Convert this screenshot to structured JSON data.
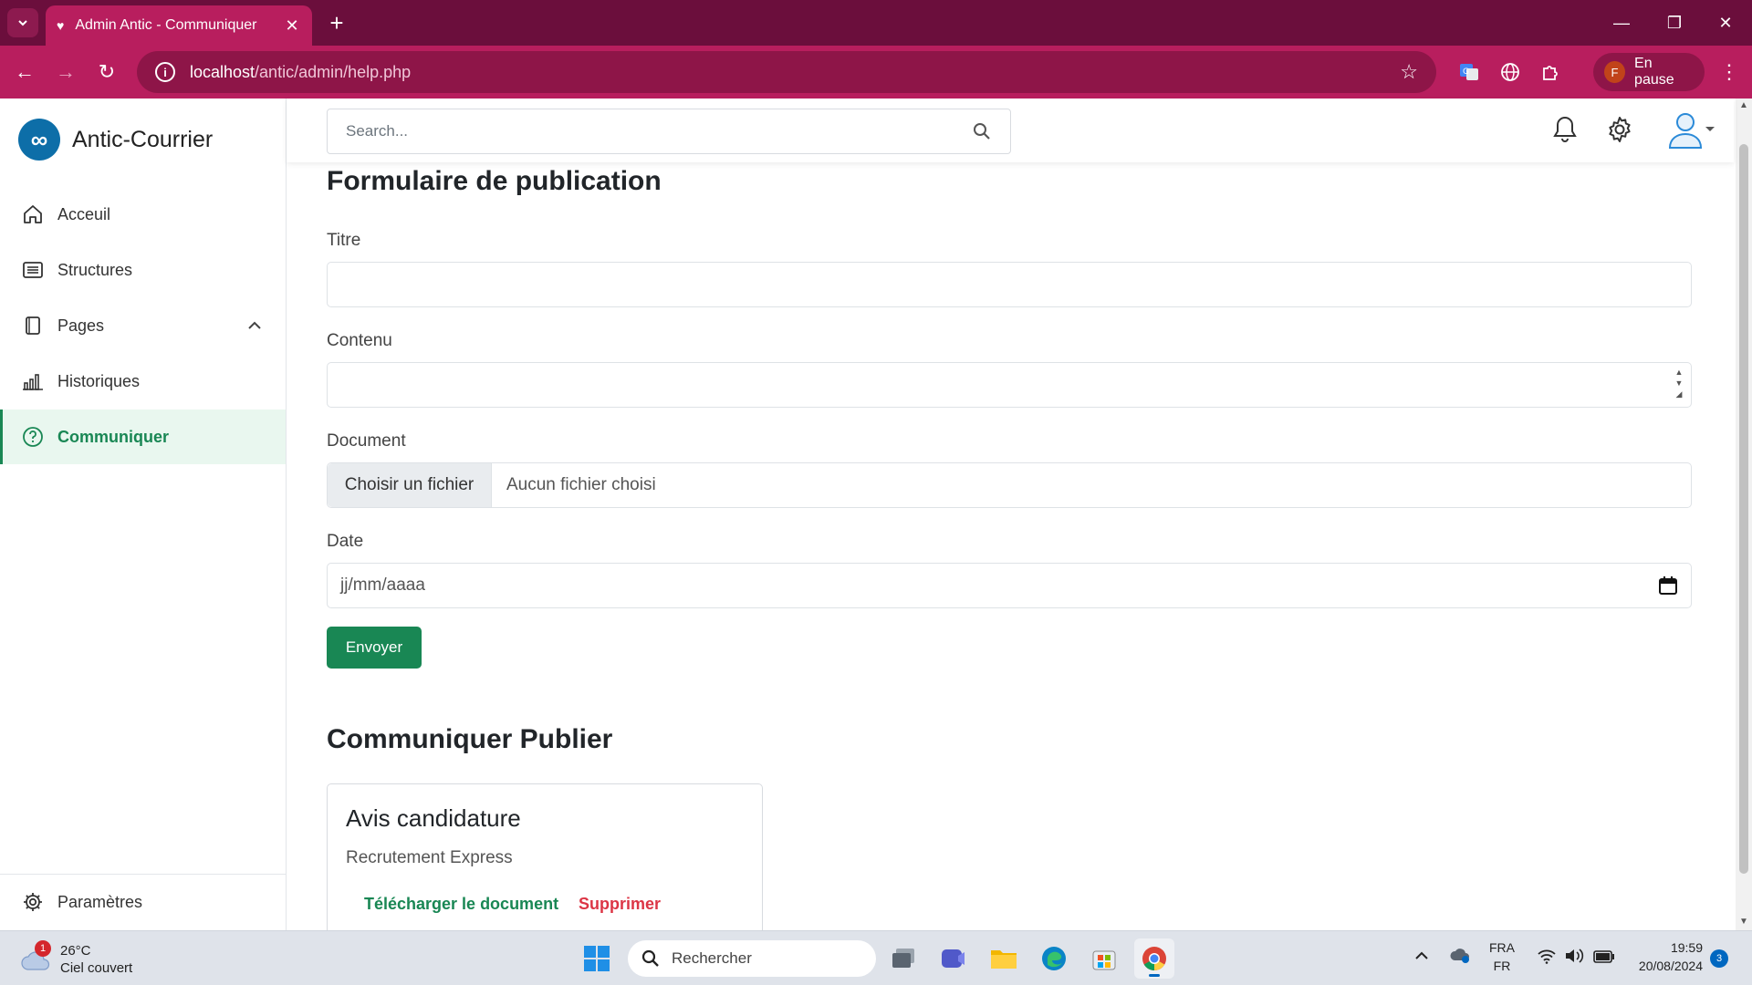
{
  "browser": {
    "tab_title": "Admin Antic - Communiquer",
    "url_host": "localhost",
    "url_path": "/antic/admin/help.php",
    "profile_initial": "F",
    "profile_status": "En pause"
  },
  "sidebar": {
    "brand": "Antic-Courrier",
    "items": [
      {
        "label": "Acceuil",
        "icon": "home-icon"
      },
      {
        "label": "Structures",
        "icon": "list-icon"
      },
      {
        "label": "Pages",
        "icon": "pages-icon"
      },
      {
        "label": "Historiques",
        "icon": "bar-chart-icon"
      },
      {
        "label": "Communiquer",
        "icon": "help-circle-icon",
        "active": true
      }
    ],
    "footer_label": "Paramètres"
  },
  "header": {
    "search_placeholder": "Search..."
  },
  "form": {
    "heading": "Formulaire de publication",
    "titre_label": "Titre",
    "contenu_label": "Contenu",
    "document_label": "Document",
    "file_button": "Choisir un fichier",
    "file_status": "Aucun fichier choisi",
    "date_label": "Date",
    "date_placeholder": "jj/mm/aaaa",
    "submit": "Envoyer"
  },
  "published": {
    "heading": "Communiquer Publier",
    "cards": [
      {
        "title": "Avis candidature",
        "subtitle": "Recrutement Express",
        "download": "Télécharger le document",
        "delete": "Supprimer"
      }
    ]
  },
  "taskbar": {
    "weather_temp": "26°C",
    "weather_desc": "Ciel couvert",
    "weather_badge": "1",
    "search_label": "Rechercher",
    "lang_top": "FRA",
    "lang_bottom": "FR",
    "time": "19:59",
    "date": "20/08/2024",
    "notification_count": "3"
  },
  "colors": {
    "accent": "#198754",
    "danger": "#dc3545",
    "chrome_dark": "#6b0e3c",
    "chrome": "#b81e5e",
    "brand_logo": "#0d6ea8"
  }
}
